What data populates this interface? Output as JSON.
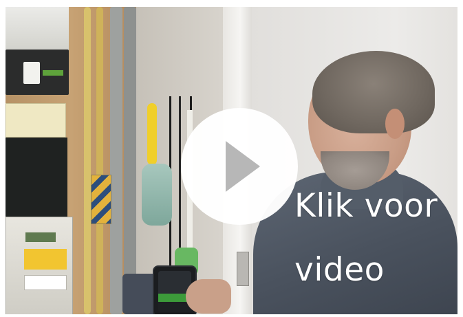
{
  "video": {
    "overlay_text_line1": "Klik voor",
    "overlay_text_line2": "video",
    "play_icon": "play-icon"
  },
  "colors": {
    "overlay_text": "#ffffff",
    "play_button_bg": "#ffffff",
    "play_triangle": "#aaaaaa"
  }
}
